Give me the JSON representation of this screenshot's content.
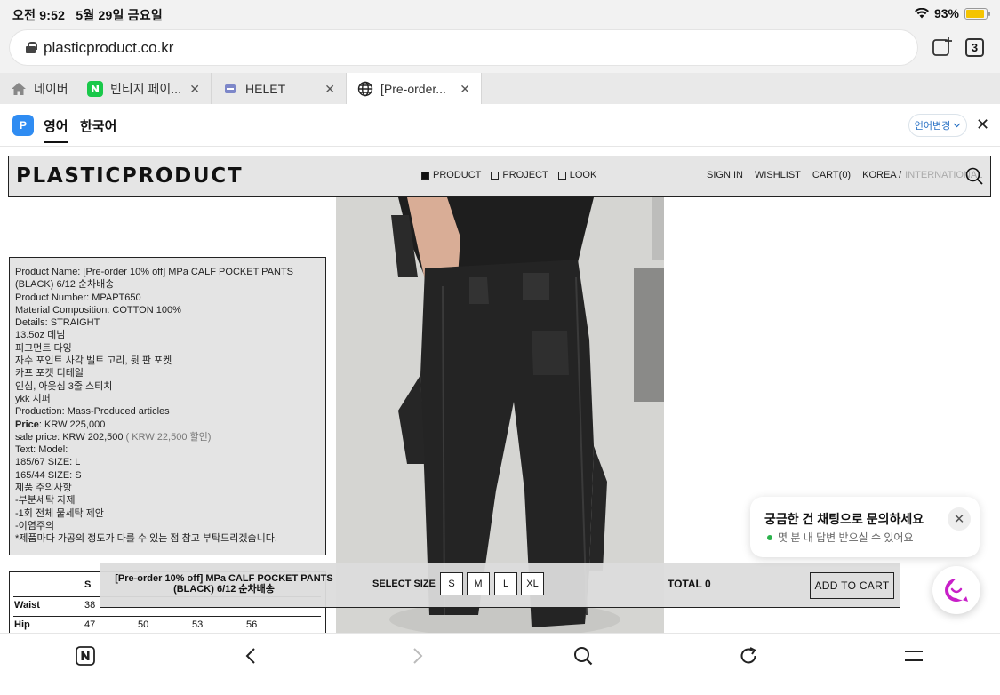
{
  "status_bar": {
    "time": "오전 9:52",
    "date": "5월 29일 금요일",
    "battery": "93%"
  },
  "address_bar": {
    "url": "plasticproduct.co.kr",
    "tab_count": "3"
  },
  "tabs": [
    {
      "label": "네이버",
      "icon": "home-icon"
    },
    {
      "label": "빈티지 페이...",
      "icon": "naver-n-icon"
    },
    {
      "label": "HELET",
      "icon": "site-icon"
    },
    {
      "label": "[Pre-order...",
      "icon": "globe-icon"
    }
  ],
  "translation": {
    "badge": "P",
    "lang_en": "영어",
    "lang_ko": "한국어",
    "change_button": "언어변경"
  },
  "site": {
    "logo": "PLASTICPRODUCT",
    "nav": [
      "PRODUCT",
      "PROJECT",
      "LOOK"
    ],
    "sign_in": "SIGN IN",
    "wishlist": "WISHLIST",
    "cart": "CART(0)",
    "korea": "KOREA /",
    "international": "INTERNATIONAL"
  },
  "product": {
    "lines": [
      "Product Name: [Pre-order 10% off] MPa CALF POCKET PANTS",
      "(BLACK) 6/12 순차배송",
      "Product Number: MPAPT650",
      "Material Composition: COTTON 100%",
      "Details: STRAIGHT",
      "13.5oz 데님",
      "피그먼트 다잉",
      "자수 포인트 사각 벨트 고리, 뒷 판 포켓",
      "카프 포켓 디테일",
      "인심, 아웃심 3줄 스티치",
      "ykk 지퍼",
      "Production: Mass-Produced articles"
    ],
    "price_label": "Price",
    "price": ": KRW 225,000",
    "sale_label": "sale price: KRW 202,500",
    "sale_discount": "( KRW 22,500 할인)",
    "lines2": [
      "Text: Model:",
      "185/67 SIZE: L",
      "165/44 SIZE: S",
      "제품 주의사항",
      "-부분세탁 자제",
      "-1회 전체 물세탁 제안",
      "-이염주의",
      "*제품마다 가공의 정도가 다를 수 있는 점 참고 부탁드리겠습니다."
    ]
  },
  "size_table": {
    "header": [
      "S"
    ],
    "rows": [
      {
        "label": "Waist",
        "values": [
          "38"
        ]
      },
      {
        "label": "Hip",
        "values": [
          "47",
          "50",
          "53",
          "56"
        ]
      }
    ]
  },
  "order_bar": {
    "title": "[Pre-order 10% off] MPa CALF POCKET PANTS (BLACK) 6/12 순차배송",
    "select_size": "SELECT SIZE",
    "sizes": [
      "S",
      "M",
      "L",
      "XL"
    ],
    "total": "TOTAL  0",
    "add_to_cart": "ADD TO CART"
  },
  "chat": {
    "title": "궁금한 건 채팅으로 문의하세요",
    "subtitle": "몇 분 내 답변 받으실 수 있어요"
  },
  "colors": {
    "accent": "#2f8cf2",
    "chat_brand": "#c81fc8",
    "online": "#2bb24c",
    "battery": "#f5c400"
  }
}
